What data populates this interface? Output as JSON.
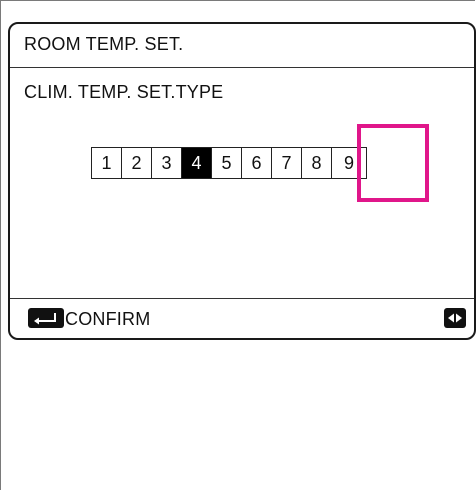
{
  "screen": {
    "title": "ROOM TEMP. SET.",
    "subtitle": "CLIM. TEMP. SET.TYPE"
  },
  "selector": {
    "options": [
      "1",
      "2",
      "3",
      "4",
      "5",
      "6",
      "7",
      "8",
      "9"
    ],
    "selected": "4",
    "highlighted": "9"
  },
  "footer": {
    "confirm_label": "CONFIRM",
    "confirm_icon": "enter-key-icon",
    "navigate_icon": "left-right-arrows-icon"
  },
  "colors": {
    "highlight": "#e0168a",
    "selected_bg": "#000000",
    "selected_fg": "#ffffff"
  }
}
